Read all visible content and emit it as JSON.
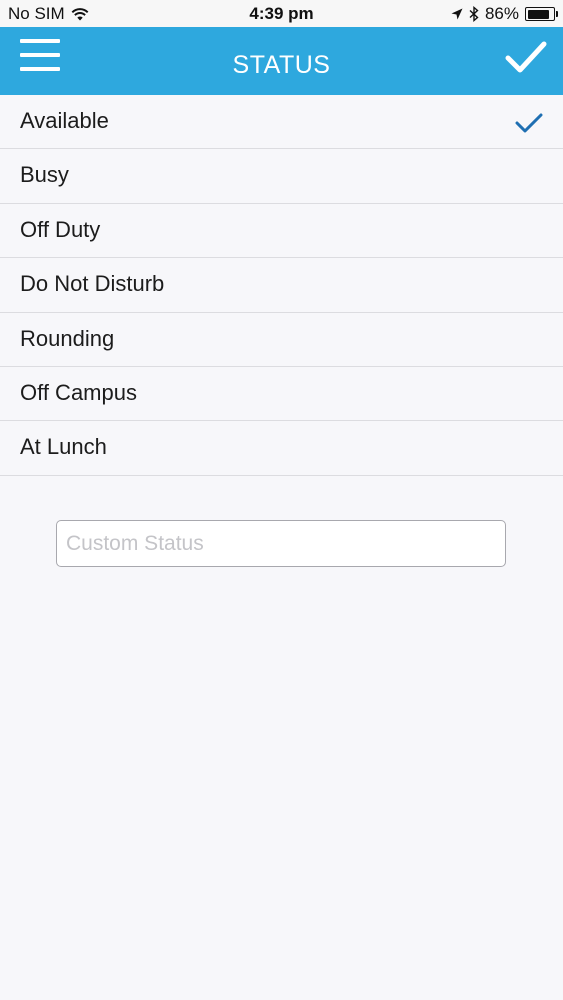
{
  "status_bar": {
    "carrier": "No SIM",
    "time": "4:39 pm",
    "battery_percent": "86%",
    "battery_level": 0.86,
    "icons": [
      "wifi-icon",
      "location-arrow-icon",
      "bluetooth-icon",
      "battery-icon"
    ]
  },
  "nav": {
    "title": "STATUS",
    "left_icon": "hamburger-menu-icon",
    "right_icon": "checkmark-icon",
    "background": "#2ea8de"
  },
  "statuses": [
    {
      "label": "Available",
      "selected": true
    },
    {
      "label": "Busy",
      "selected": false
    },
    {
      "label": "Off Duty",
      "selected": false
    },
    {
      "label": "Do Not Disturb",
      "selected": false
    },
    {
      "label": "Rounding",
      "selected": false
    },
    {
      "label": "Off Campus",
      "selected": false
    },
    {
      "label": "At Lunch",
      "selected": false
    }
  ],
  "selected_check_color": "#1f6fb2",
  "custom_status": {
    "placeholder": "Custom Status",
    "value": ""
  }
}
